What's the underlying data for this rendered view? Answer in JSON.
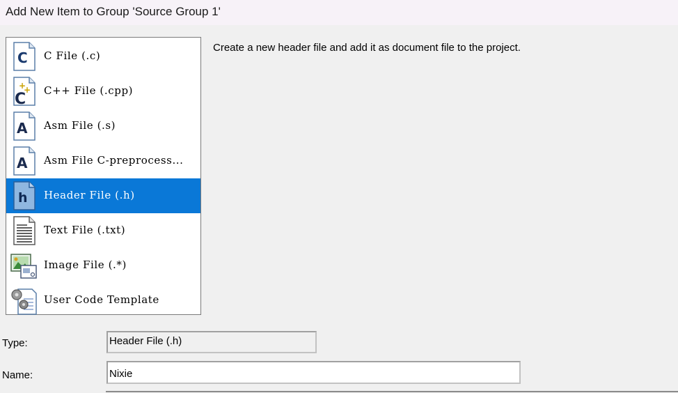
{
  "window": {
    "title": "Add New Item to Group 'Source Group 1'"
  },
  "file_types": [
    {
      "label": "C File (.c)",
      "icon": "c-file-icon",
      "selected": false
    },
    {
      "label": "C++ File (.cpp)",
      "icon": "cpp-file-icon",
      "selected": false
    },
    {
      "label": "Asm File (.s)",
      "icon": "asm-file-icon",
      "selected": false
    },
    {
      "label": "Asm File C-preprocess...",
      "icon": "asm-preprocess-file-icon",
      "selected": false
    },
    {
      "label": "Header File (.h)",
      "icon": "header-file-icon",
      "selected": true
    },
    {
      "label": "Text File (.txt)",
      "icon": "text-file-icon",
      "selected": false
    },
    {
      "label": "Image File (.*)",
      "icon": "image-file-icon",
      "selected": false
    },
    {
      "label": "User Code Template",
      "icon": "user-code-template-icon",
      "selected": false
    }
  ],
  "description": "Create a new header file and add it as document file to the project.",
  "form": {
    "type_label": "Type:",
    "type_value": "Header File (.h)",
    "name_label": "Name:",
    "name_value": "Nixie"
  },
  "colors": {
    "selection": "#0a78d7",
    "title_bg": "#f7f2f8",
    "dialog_bg": "#f0f0f0"
  }
}
